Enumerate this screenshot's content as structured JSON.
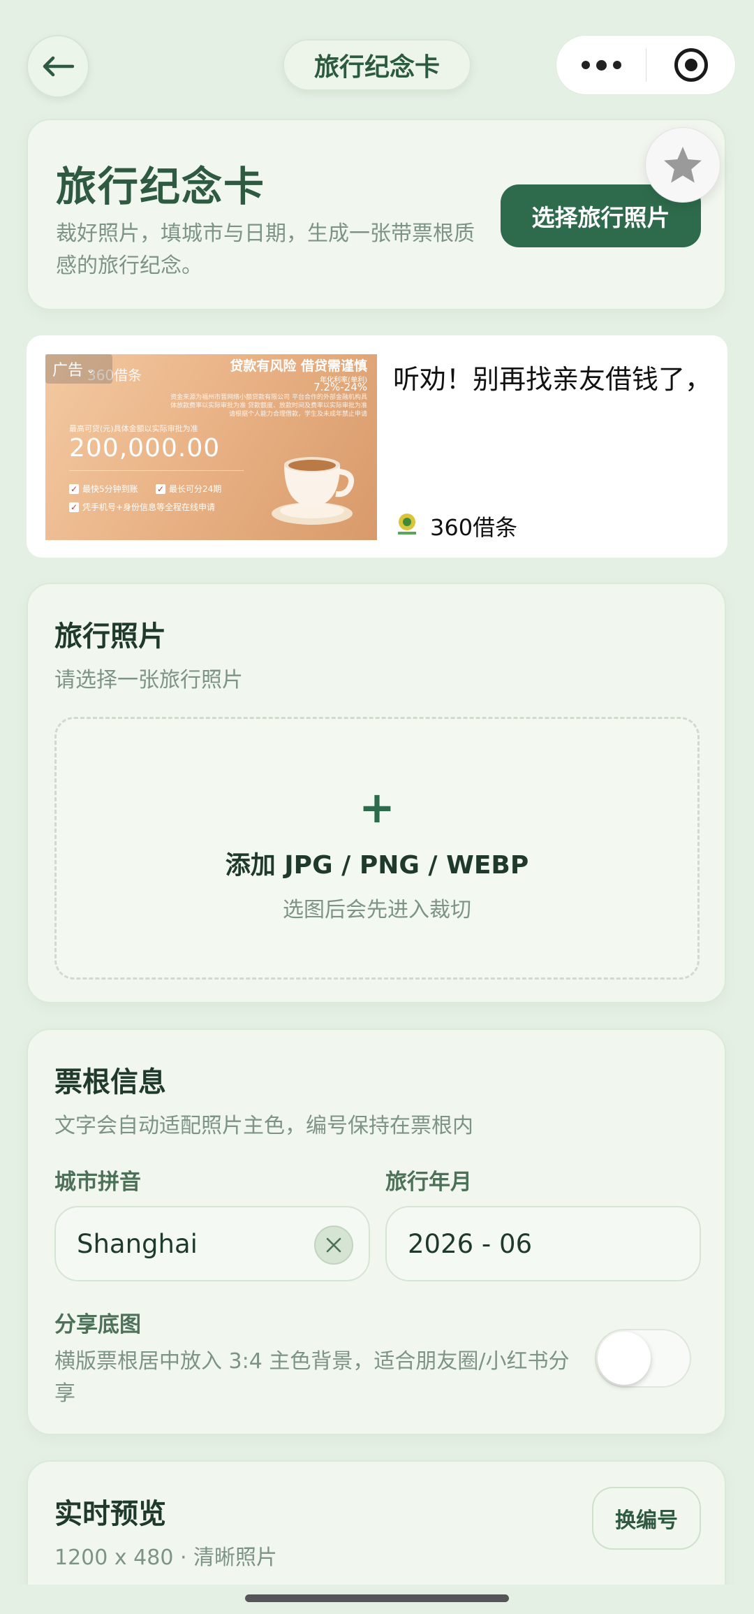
{
  "nav": {
    "title": "旅行纪念卡"
  },
  "hero": {
    "title": "旅行纪念卡",
    "description": "裁好照片，填城市与日期，生成一张带票根质感的旅行纪念。",
    "choose_button": "选择旅行照片"
  },
  "ad": {
    "tag": "广告",
    "brand": "360借条",
    "risk": "贷款有风险 借贷需谨慎",
    "rate_label": "年化利率(单利)",
    "rate": "7.2%-24%",
    "fine_print": "资金来源为福州市晋网络小额贷款有限公司 平台合作的外部金融机构具体放款费率以实际审批为准 贷款额度、放款时间及费率以实际审批为准 请根据个人能力合理借款，学生及未成年禁止申请",
    "limit_label": "最高可贷(元)具体金额以实际审批为准",
    "amount": "200,000.00",
    "feature_1": "最快5分钟到账",
    "feature_2": "最长可分24期",
    "feature_3": "凭手机号+身份信息等全程在线申请",
    "headline": "听劝！别再找亲友借钱了，",
    "advertiser": "360借条"
  },
  "photo": {
    "title": "旅行照片",
    "subtitle": "请选择一张旅行照片",
    "upload_plus": "+",
    "upload_label": "添加 JPG / PNG / WEBP",
    "upload_hint": "选图后会先进入裁切"
  },
  "ticket": {
    "title": "票根信息",
    "subtitle": "文字会自动适配照片主色，编号保持在票根内",
    "city_label": "城市拼音",
    "city_value": "Shanghai",
    "date_label": "旅行年月",
    "date_value": "2026 - 06",
    "share_label": "分享底图",
    "share_desc": "横版票根居中放入 3:4 主色背景，适合朋友圈/小红书分享",
    "share_enabled": false
  },
  "preview": {
    "title": "实时预览",
    "subtitle": "1200 x 480 · 清晰照片",
    "swap_button": "换编号"
  },
  "colors": {
    "background": "#e5f0e4",
    "accent": "#2e6b4c",
    "card": "#f1f7ef"
  }
}
